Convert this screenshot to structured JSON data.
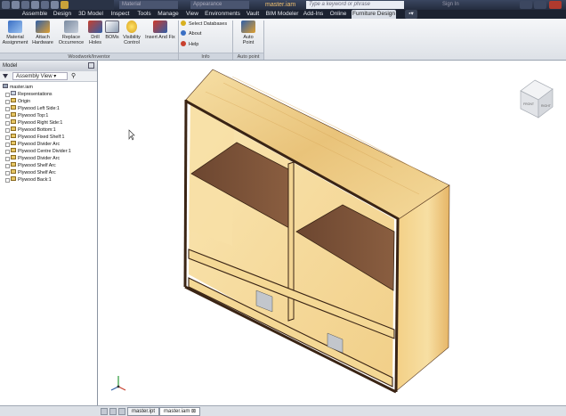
{
  "titlebar": {
    "material_value": "Material",
    "appearance_value": "Appearance",
    "document_name": "master.iam",
    "search_placeholder": "Type a keyword or phrase",
    "signin_label": "Sign In"
  },
  "ribbon_tabs": [
    "Assemble",
    "Design",
    "3D Model",
    "Inspect",
    "Tools",
    "Manage",
    "View",
    "Environments",
    "Vault",
    "BIM Modeler",
    "Add-Ins",
    "Online",
    "Furniture Design"
  ],
  "active_tab": "Furniture Design",
  "woodwork_panel": {
    "label": "Woodwork/Inventor",
    "buttons": [
      {
        "label": "Material\nAssignment"
      },
      {
        "label": "Attach\nHardware"
      },
      {
        "label": "Replace\nOccurrence"
      },
      {
        "label": "Drill\nHoles"
      },
      {
        "label": "BOMs"
      },
      {
        "label": "Visibility\nControl"
      },
      {
        "label": "Insert And Fix"
      }
    ]
  },
  "info_panel": {
    "label": "Info",
    "items": [
      "Select Databases",
      "About",
      "Help"
    ]
  },
  "autopoint_panel": {
    "label": "Auto point",
    "button": "Auto\nPoint"
  },
  "browser": {
    "title": "Model",
    "view_selector": "Assembly View",
    "root": "master.iam",
    "nodes": [
      "Representations",
      "Origin",
      "Plywood Left Side:1",
      "Plywood Top:1",
      "Plywood Right Side:1",
      "Plywood Bottom:1",
      "Plywood Fixed Shelf:1",
      "Plywood Divider Arc",
      "Plywood Centre Divider:1",
      "Plywood Divider Arc",
      "Plywood Shelf Arc",
      "Plywood Shelf Arc",
      "Plywood Back:1"
    ]
  },
  "viewcube": {
    "front": "FRONT",
    "right": "RIGHT"
  },
  "document_tabs": [
    "master.ipt",
    "master.iam"
  ],
  "active_document": "master.iam",
  "colors": {
    "wood_light": "#f3d79a",
    "wood_edge": "#3a2414",
    "shelf": "#7a5438",
    "active_tab": "#d8dde6"
  }
}
